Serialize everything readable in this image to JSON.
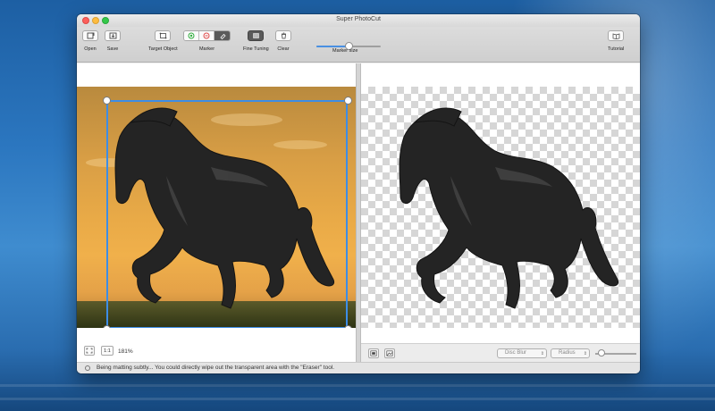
{
  "window": {
    "title": "Super PhotoCut"
  },
  "toolbar": {
    "open_label": "Open",
    "save_label": "Save",
    "target_label": "Target Object",
    "marker_label": "Marker",
    "fine_tuning_label": "Fine Tuning",
    "clear_label": "Clear",
    "marker_size_label": "Marker size",
    "tutorial_label": "Tutorial",
    "marker_size_value": 0.5
  },
  "left_pane": {
    "actual_size_label": "1:1",
    "zoom_level": "181%"
  },
  "right_pane": {
    "blur_select": "Disc Blur",
    "radius_select": "Radius",
    "radius_value": 0.15
  },
  "status": {
    "message": "Being matting subtly... You could directly wipe out the transparent area with the \"Eraser\" tool."
  },
  "colors": {
    "accent": "#3d8de6",
    "marker_keep": "#2fae3c",
    "marker_remove": "#e04b4b"
  }
}
